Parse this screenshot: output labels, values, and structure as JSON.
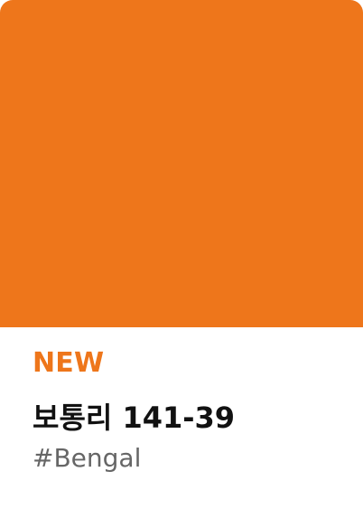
{
  "colors": {
    "swatch": "#EE761B",
    "badge_text": "#EE761B"
  },
  "card": {
    "badge": "NEW",
    "title": "보통리 141-39",
    "hashtag": "#Bengal"
  }
}
